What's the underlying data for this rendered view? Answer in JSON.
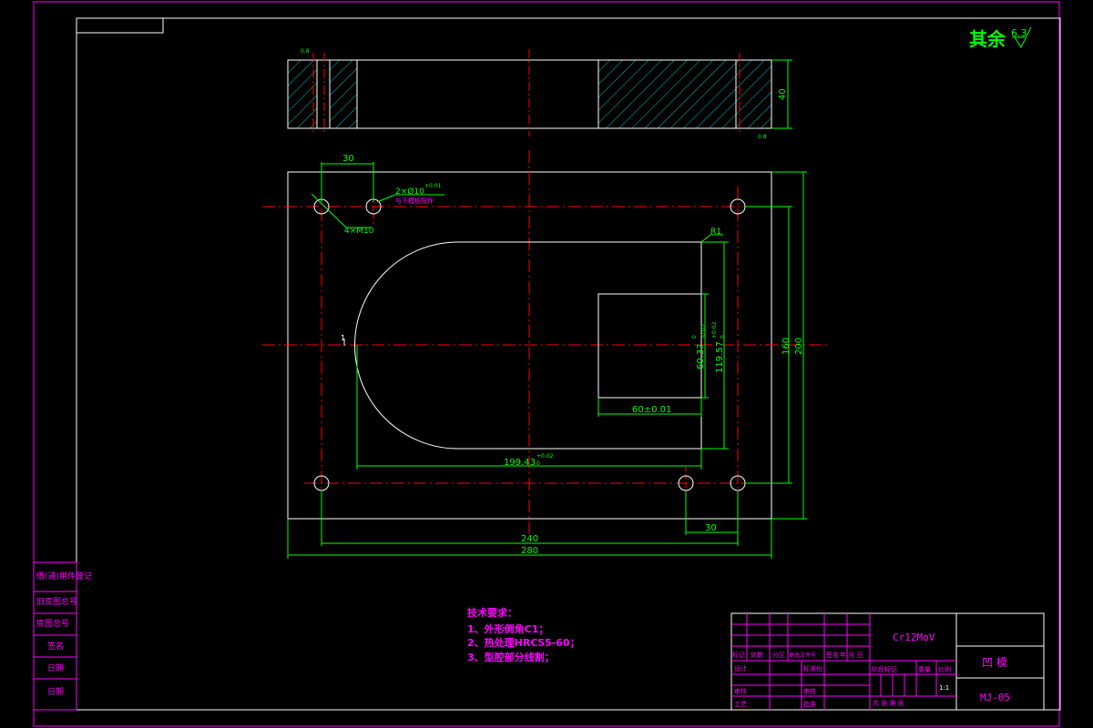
{
  "title_block": {
    "material": "Cr12MoV",
    "part_name": "凹 模",
    "drawing_no": "MJ-05",
    "scale": "1:1",
    "header_row": [
      "标记",
      "处数",
      "分区",
      "更改文件号",
      "签名",
      "年 月 日"
    ],
    "left_labels": [
      "设计",
      "审核",
      "工艺"
    ],
    "mid_labels": [
      "标准化",
      "审核",
      "批准"
    ],
    "stage_row": [
      "阶段标记",
      "重量",
      "比例"
    ],
    "sheet_row": "共 张 第 张"
  },
  "left_strip": {
    "labels": [
      "借(通)用件登记",
      "旧底图总号",
      "底图总号",
      "签名",
      "日期",
      "日期"
    ]
  },
  "surface_finish": {
    "label": "其余",
    "value": "6.3"
  },
  "dimensions": {
    "hole_pitch": "30",
    "pin_hole": "2×Ø10",
    "pin_tol": "+0.01",
    "pin_note": "与下模板配作",
    "thread": "4×M10",
    "radius": "R1",
    "thickness": "40",
    "small_width": "60±0.01",
    "small_height": "60.37",
    "small_height_tol_up": "0",
    "small_height_tol_low": "-0.02",
    "opening_height": "119.57",
    "opening_height_tol_up": "+0.02",
    "opening_height_tol_low": "0",
    "opening_length": "199.43",
    "opening_length_tol_up": "+0.02",
    "opening_length_tol_low": "0",
    "hole_span_x": "240",
    "outer_x": "280",
    "hole_span_y": "160",
    "outer_y": "200",
    "bottom_offset": "30",
    "roughness_top": "0.8",
    "roughness_side": "0.8",
    "side_mark": "1"
  },
  "tech_notes": {
    "title": "技术要求：",
    "items": [
      "1、外形倒角C1；",
      "2、热处理HRC55-60；",
      "3、型腔部分线割；"
    ]
  },
  "colors": {
    "border": "#ff00ff",
    "outline": "#ffffff",
    "center": "#ff0000",
    "dim": "#00ff00",
    "hatch": "#00c0c0",
    "note": "#ff00ff",
    "rough": "#00ff00"
  }
}
